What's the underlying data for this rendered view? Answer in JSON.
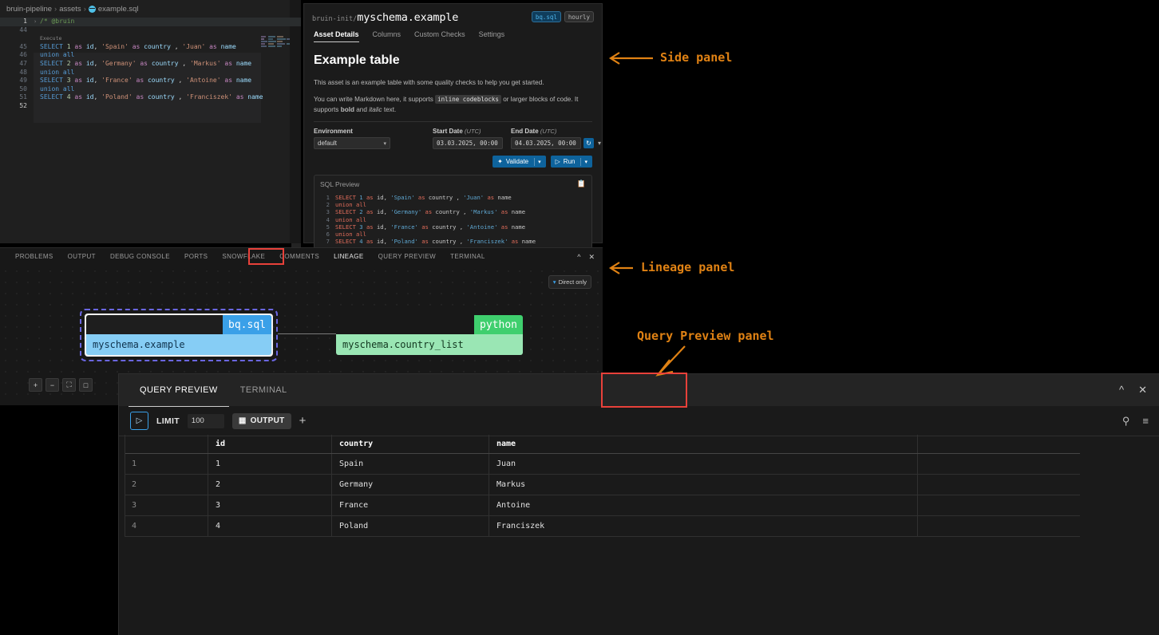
{
  "editor": {
    "breadcrumb": [
      "bruin-pipeline",
      "assets",
      "example.sql"
    ],
    "lines": [
      {
        "n": "1",
        "fold": "›",
        "text": "/* @bruin",
        "cls": "cm",
        "hl": true
      },
      {
        "n": "44",
        "text": "",
        "cls": "pl"
      },
      {
        "n": "",
        "text": "Execute",
        "cls": "cm"
      },
      {
        "n": "45",
        "text": "SELECT 1 as id, 'Spain' as country , 'Juan' as name"
      },
      {
        "n": "46",
        "text": "union all"
      },
      {
        "n": "47",
        "text": "SELECT 2 as id, 'Germany' as country , 'Markus' as name"
      },
      {
        "n": "48",
        "text": "union all"
      },
      {
        "n": "49",
        "text": "SELECT 3 as id, 'France' as country , 'Antoine' as name"
      },
      {
        "n": "50",
        "text": "union all"
      },
      {
        "n": "51",
        "text": "SELECT 4 as id, 'Poland' as country , 'Franciszek' as name"
      },
      {
        "n": "52",
        "text": ""
      }
    ]
  },
  "side_panel": {
    "title_prefix": "bruin-init/",
    "title_main": "myschema.example",
    "badges": [
      {
        "label": "bq.sql",
        "kind": "sql"
      },
      {
        "label": "hourly",
        "kind": "sched"
      }
    ],
    "tabs": [
      {
        "label": "Asset Details",
        "active": true
      },
      {
        "label": "Columns",
        "active": false
      },
      {
        "label": "Custom Checks",
        "active": false
      },
      {
        "label": "Settings",
        "active": false
      }
    ],
    "heading": "Example table",
    "paragraph1": "This asset is an example table with some quality checks to help you get started.",
    "paragraph2_a": "You can write Markdown here, it supports ",
    "paragraph2_code": "inline codeblocks",
    "paragraph2_b": " or larger blocks of code. It supports ",
    "paragraph2_bold": "bold",
    "paragraph2_c": " and ",
    "paragraph2_italic": "italic",
    "paragraph2_d": " text.",
    "environment_label": "Environment",
    "environment_value": "default",
    "start_date_label": "Start Date",
    "start_date_unit": "(UTC)",
    "start_date_value": "03.03.2025, 00:00",
    "end_date_label": "End Date",
    "end_date_unit": "(UTC)",
    "end_date_value": "04.03.2025, 00:00",
    "validate_label": "Validate",
    "run_label": "Run",
    "sql_preview_title": "SQL Preview",
    "sql_preview_lines": [
      "SELECT 1 as id, 'Spain' as country , 'Juan' as name",
      "union all",
      "SELECT 2 as id, 'Germany' as country , 'Markus' as name",
      "union all",
      "SELECT 3 as id, 'France' as country , 'Antoine' as name",
      "union all",
      "SELECT 4 as id, 'Poland' as country , 'Franciszek' as name"
    ]
  },
  "lineage_panel": {
    "tabs": [
      {
        "label": "PROBLEMS",
        "active": false
      },
      {
        "label": "OUTPUT",
        "active": false
      },
      {
        "label": "DEBUG CONSOLE",
        "active": false
      },
      {
        "label": "PORTS",
        "active": false
      },
      {
        "label": "SNOWFLAKE",
        "active": false
      },
      {
        "label": "COMMENTS",
        "active": false
      },
      {
        "label": "LINEAGE",
        "active": true
      },
      {
        "label": "QUERY PREVIEW",
        "active": false
      },
      {
        "label": "TERMINAL",
        "active": false
      }
    ],
    "filter_label": "Direct only",
    "nodes": [
      {
        "name": "myschema.example",
        "tag": "bq.sql",
        "selected": true
      },
      {
        "name": "myschema.country_list",
        "tag": "python",
        "selected": false
      }
    ],
    "zoom_buttons": [
      "+",
      "−",
      "⛶",
      "🔒"
    ]
  },
  "query_preview": {
    "tabs": [
      {
        "label": "QUERY PREVIEW",
        "active": true
      },
      {
        "label": "TERMINAL",
        "active": false
      }
    ],
    "limit_label": "LIMIT",
    "limit_value": "100",
    "output_label": "OUTPUT",
    "add_label": "+",
    "columns": [
      "",
      "id",
      "country",
      "name"
    ],
    "rows": [
      [
        "1",
        "1",
        "Spain",
        "Juan"
      ],
      [
        "2",
        "2",
        "Germany",
        "Markus"
      ],
      [
        "3",
        "3",
        "France",
        "Antoine"
      ],
      [
        "4",
        "4",
        "Poland",
        "Franciszek"
      ]
    ]
  },
  "annotations": [
    {
      "text": "Side panel"
    },
    {
      "text": "Lineage panel"
    },
    {
      "text": "Query Preview panel"
    }
  ],
  "colors": {
    "accent_blue": "#0e639c",
    "annotation_orange": "#e08214",
    "highlight_red": "#e8413a",
    "node_blue": "#86cdf5",
    "node_green": "#9ae6b4"
  }
}
